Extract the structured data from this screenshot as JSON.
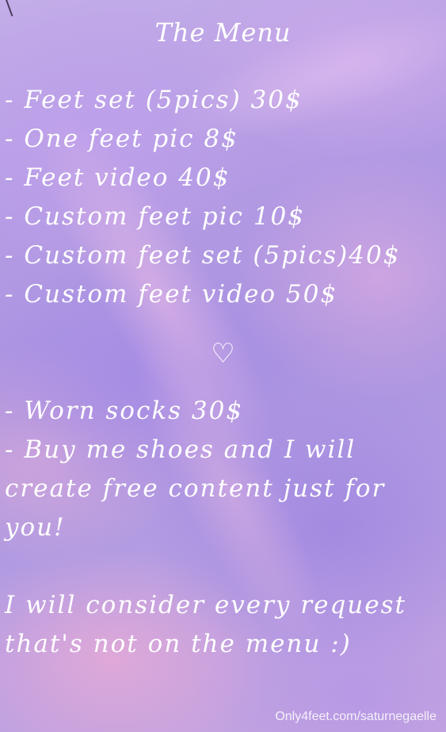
{
  "title": "The Menu",
  "menu_items": [
    "- Feet set (5pics) 30$",
    "- One feet pic 8$",
    "- Feet video 40$",
    "- Custom feet pic 10$",
    "- Custom feet set (5pics)40$",
    "- Custom feet video 50$"
  ],
  "divider_symbol": "♡",
  "extras": [
    "- Worn socks 30$",
    "- Buy me shoes and I will",
    "create free content just for",
    "you!"
  ],
  "closing": [
    "I will consider every request",
    "that's not on the menu :)"
  ],
  "watermark": "Only4feet.com/saturnegaelle"
}
